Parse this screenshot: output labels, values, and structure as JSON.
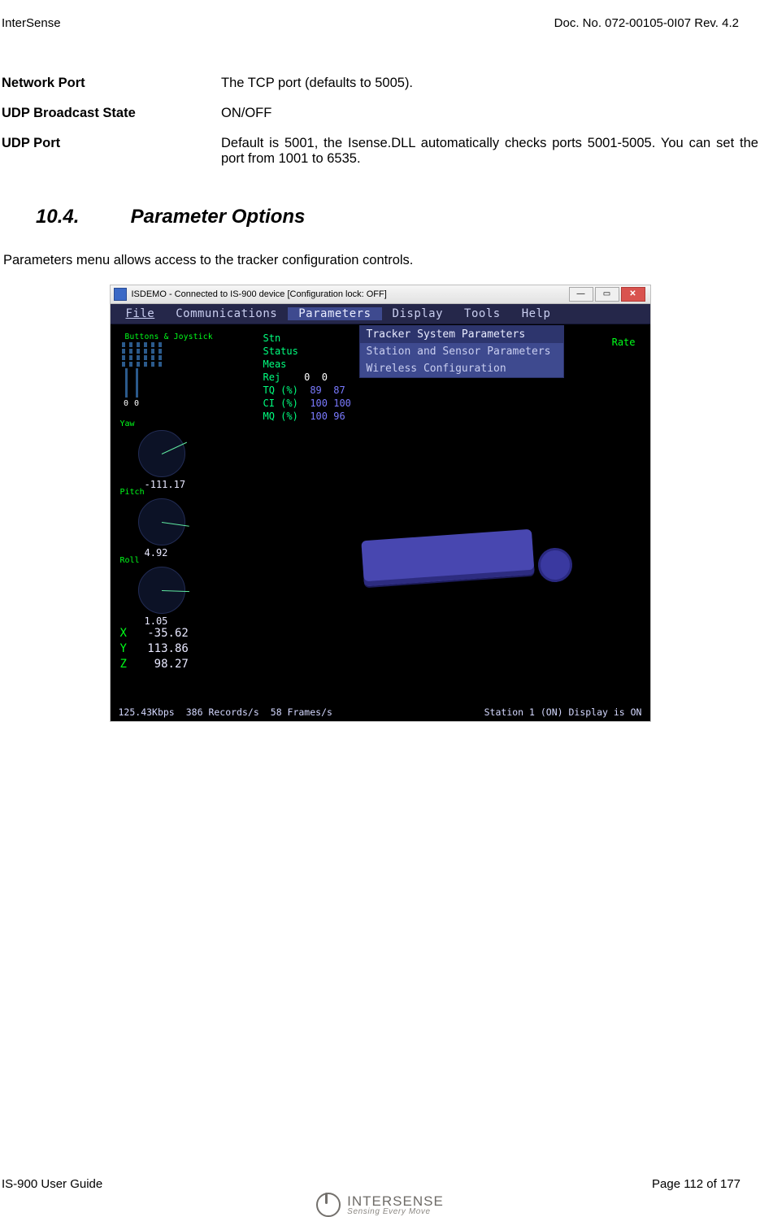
{
  "header": {
    "left": "InterSense",
    "right": "Doc. No. 072-00105-0I07 Rev. 4.2"
  },
  "params": {
    "network_port": {
      "term": "Network Port",
      "desc": "The TCP port (defaults to 5005)."
    },
    "udp_bcast": {
      "term": "UDP Broadcast State",
      "desc": "ON/OFF"
    },
    "udp_port": {
      "term": "UDP Port",
      "desc": "Default is 5001, the Isense.DLL automatically checks ports 5001-5005. You can set the port from 1001 to 6535."
    }
  },
  "section": {
    "number": "10.4.",
    "title": "Parameter Options"
  },
  "intro": "Parameters menu allows access to the tracker configuration controls.",
  "screenshot": {
    "window_title": "ISDEMO - Connected to IS-900 device [Configuration lock: OFF]",
    "menubar": {
      "file": "File",
      "comm": "Communications",
      "params": "Parameters",
      "display": "Display",
      "tools": "Tools",
      "help": "Help"
    },
    "dropdown": {
      "item0": "Tracker System Parameters",
      "item1": "Station and Sensor Parameters",
      "item2": "Wireless Configuration"
    },
    "bj_title": "Buttons & Joystick",
    "joy": {
      "v0": "0",
      "v1": "0"
    },
    "rate_label": "Rate",
    "table": {
      "stn": {
        "l": "Stn"
      },
      "status": {
        "l": "Status"
      },
      "meas": {
        "l": "Meas"
      },
      "rej": {
        "l": "Rej",
        "a": "0",
        "b": "0"
      },
      "tq": {
        "l": "TQ (%)",
        "a": "89",
        "b": "87"
      },
      "ci": {
        "l": "CI (%)",
        "a": "100",
        "b": "100"
      },
      "mq": {
        "l": "MQ (%)",
        "a": "100",
        "b": "96"
      }
    },
    "gauges": {
      "yaw": {
        "label": "Yaw",
        "value": "-111.17"
      },
      "pitch": {
        "label": "Pitch",
        "value": "4.92"
      },
      "roll": {
        "label": "Roll",
        "value": "1.05"
      }
    },
    "xyz": {
      "x": {
        "l": "X",
        "v": "-35.62"
      },
      "y": {
        "l": "Y",
        "v": "113.86"
      },
      "z": {
        "l": "Z",
        "v": "98.27"
      }
    },
    "statusbar": {
      "kbps": "125.43Kbps",
      "recs": "386 Records/s",
      "fps": "58 Frames/s",
      "station": "Station 1 (ON) Display is ON"
    }
  },
  "footer": {
    "left": "IS-900 User Guide",
    "right": "Page 112 of 177",
    "logo_title": "INTERSENSE",
    "logo_sub": "Sensing Every Move"
  }
}
